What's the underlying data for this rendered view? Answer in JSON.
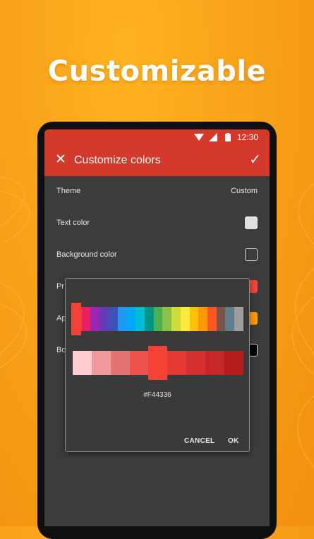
{
  "promo": {
    "headline": "Customizable"
  },
  "statusbar": {
    "time": "12:30",
    "icons": [
      "wifi-icon",
      "signal-icon",
      "battery-icon"
    ]
  },
  "appbar": {
    "title": "Customize colors",
    "close_icon": "close-icon",
    "confirm_icon": "check-icon",
    "color": "#D43A2B"
  },
  "settings": [
    {
      "label": "Theme",
      "value": "Custom"
    },
    {
      "label": "Text color",
      "swatch": "#E0E0E0"
    },
    {
      "label": "Background color",
      "swatch": "#3C3C3C"
    },
    {
      "label": "Pr",
      "swatch": "#F44336"
    },
    {
      "label": "Ap",
      "swatch": "#FF9800"
    },
    {
      "label": "Bo",
      "swatch": "#000000"
    }
  ],
  "dialog": {
    "hue_palette": [
      "#F44336",
      "#E91E63",
      "#9C27B0",
      "#673AB7",
      "#3F51B5",
      "#2196F3",
      "#03A9F4",
      "#00BCD4",
      "#009688",
      "#4CAF50",
      "#8BC34A",
      "#CDDC39",
      "#FFEB3B",
      "#FFC107",
      "#FF9800",
      "#FF5722",
      "#795548",
      "#607D8B",
      "#9E9E9E"
    ],
    "shade_palette": [
      "#FFCDD2",
      "#EF9A9A",
      "#E57373",
      "#EF5350",
      "#F44336",
      "#E53935",
      "#D32F2F",
      "#C62828",
      "#B71C1C"
    ],
    "selected_hex": "#F44336",
    "cancel_label": "CANCEL",
    "ok_label": "OK"
  }
}
